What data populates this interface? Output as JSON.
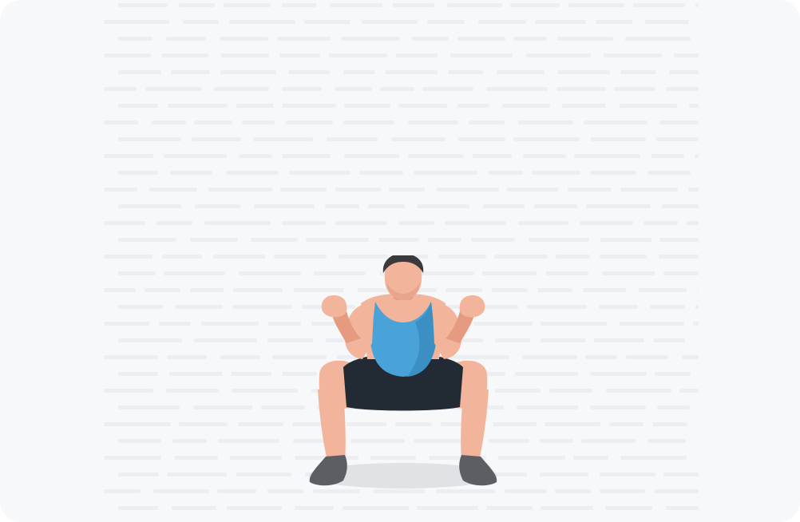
{
  "scene": {
    "subject": "squat-exercise-illustration",
    "colors": {
      "background": "#f7f8fa",
      "pattern_text": "#eceef1",
      "skin": "#f2b49a",
      "skin_shadow": "#e69a80",
      "hair": "#3a3a3c",
      "tank_top": "#4aa3d8",
      "tank_top_shadow": "#3b8fc2",
      "shorts": "#222a33",
      "shoes": "#5b5f63",
      "floor_shadow": "#e1e2e4"
    }
  }
}
